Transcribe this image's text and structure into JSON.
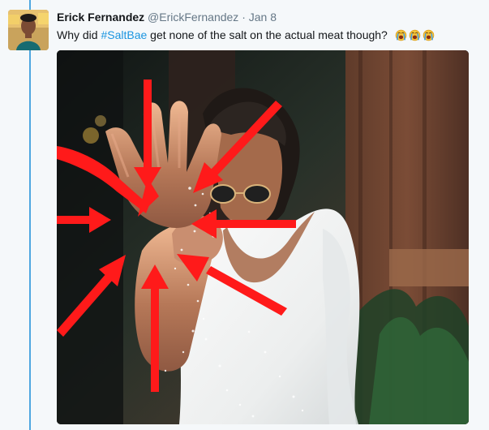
{
  "tweet": {
    "author": {
      "name": "Erick Fernandez",
      "handle": "@ErickFernandez",
      "dot": "·",
      "date": "Jan 8"
    },
    "text_before": "Why did ",
    "hashtag": "#SaltBae",
    "text_after": " get none of the salt on the actual meat though?",
    "emoji": [
      "crying-face",
      "crying-face",
      "crying-face"
    ],
    "media": {
      "description_icon": "salt-bae-photo-with-red-arrows",
      "arrow_color": "#ff1a1a",
      "shirt_color": "#ffffff"
    }
  },
  "colors": {
    "thread_line": "#4fa7e0",
    "hashtag": "#1b95e0",
    "secondary_text": "#657786"
  }
}
